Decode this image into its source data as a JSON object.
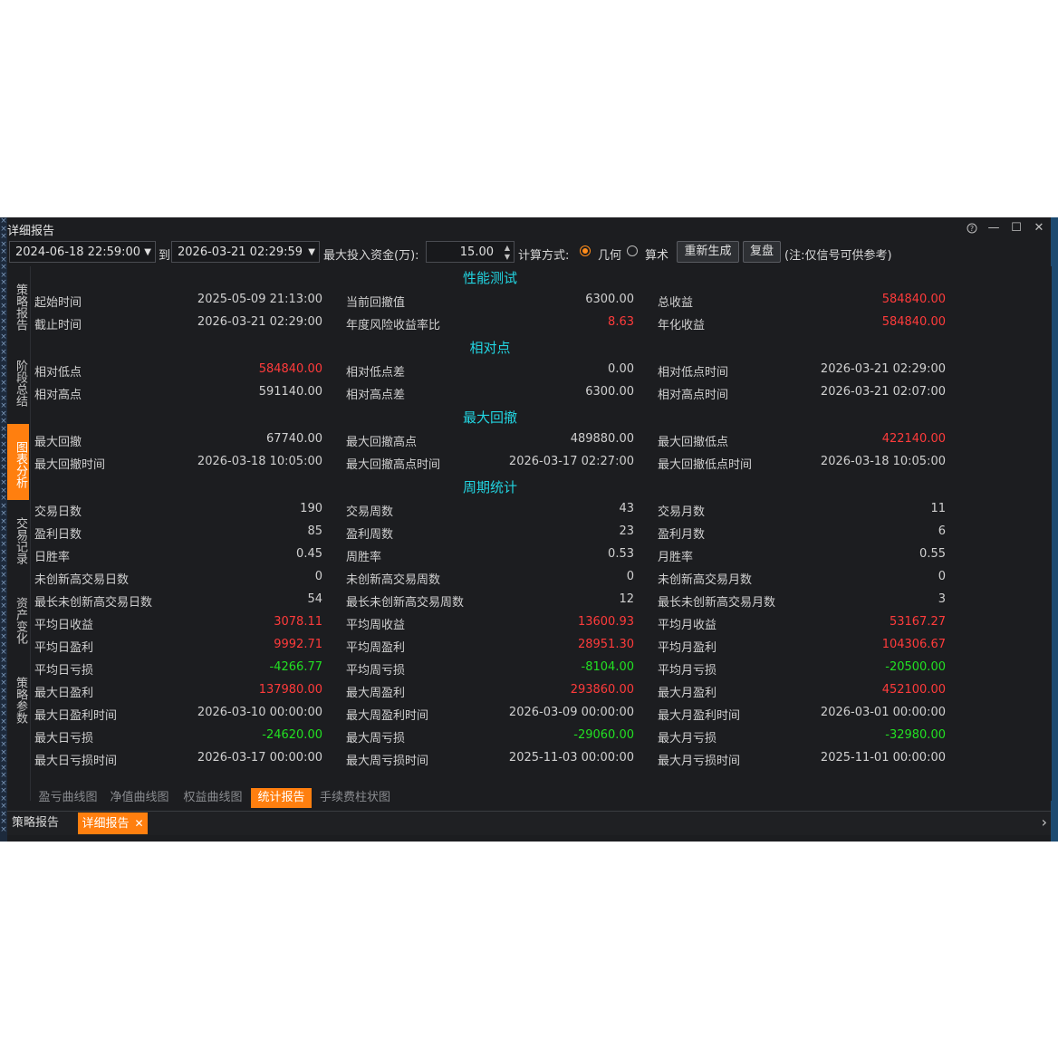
{
  "window": {
    "title": "详细报告",
    "controls": {
      "help": "?",
      "minimize": "—",
      "maximize": "☐",
      "close": "✕"
    }
  },
  "toolbar": {
    "start_date": "2024-06-18 22:59:00",
    "to_label": "到",
    "end_date": "2026-03-21 02:29:59",
    "max_capital_label": "最大投入资金(万):",
    "max_capital_value": "15.00",
    "calc_method_label": "计算方式:",
    "calc_options": [
      {
        "label": "几何",
        "selected": true
      },
      {
        "label": "算术",
        "selected": false
      }
    ],
    "regenerate_button": "重新生成",
    "review_button": "复盘",
    "note": "(注:仅信号可供参考)"
  },
  "side_tabs": [
    {
      "label": "策略报告",
      "active": false
    },
    {
      "label": "阶段总结",
      "active": false
    },
    {
      "label": "图表分析",
      "active": true
    },
    {
      "label": "交易记录",
      "active": false
    },
    {
      "label": "资产变化",
      "active": false
    },
    {
      "label": "策略参数",
      "active": false
    }
  ],
  "sections": [
    {
      "title": "性能测试",
      "rows": [
        [
          {
            "k": "起始时间",
            "v": "2025-05-09 21:13:00",
            "c": "n"
          },
          {
            "k": "当前回撤值",
            "v": "6300.00",
            "c": "n"
          },
          {
            "k": "总收益",
            "v": "584840.00",
            "c": "r"
          }
        ],
        [
          {
            "k": "截止时间",
            "v": "2026-03-21 02:29:00",
            "c": "n"
          },
          {
            "k": "年度风险收益率比",
            "v": "8.63",
            "c": "r"
          },
          {
            "k": "年化收益",
            "v": "584840.00",
            "c": "r"
          }
        ]
      ]
    },
    {
      "title": "相对点",
      "rows": [
        [
          {
            "k": "相对低点",
            "v": "584840.00",
            "c": "r"
          },
          {
            "k": "相对低点差",
            "v": "0.00",
            "c": "n"
          },
          {
            "k": "相对低点时间",
            "v": "2026-03-21 02:29:00",
            "c": "n"
          }
        ],
        [
          {
            "k": "相对高点",
            "v": "591140.00",
            "c": "n"
          },
          {
            "k": "相对高点差",
            "v": "6300.00",
            "c": "n"
          },
          {
            "k": "相对高点时间",
            "v": "2026-03-21 02:07:00",
            "c": "n"
          }
        ]
      ]
    },
    {
      "title": "最大回撤",
      "rows": [
        [
          {
            "k": "最大回撤",
            "v": "67740.00",
            "c": "n"
          },
          {
            "k": "最大回撤高点",
            "v": "489880.00",
            "c": "n"
          },
          {
            "k": "最大回撤低点",
            "v": "422140.00",
            "c": "r"
          }
        ],
        [
          {
            "k": "最大回撤时间",
            "v": "2026-03-18 10:05:00",
            "c": "n"
          },
          {
            "k": "最大回撤高点时间",
            "v": "2026-03-17 02:27:00",
            "c": "n"
          },
          {
            "k": "最大回撤低点时间",
            "v": "2026-03-18 10:05:00",
            "c": "n"
          }
        ]
      ]
    },
    {
      "title": "周期统计",
      "rows": [
        [
          {
            "k": "交易日数",
            "v": "190",
            "c": "n"
          },
          {
            "k": "交易周数",
            "v": "43",
            "c": "n"
          },
          {
            "k": "交易月数",
            "v": "11",
            "c": "n"
          }
        ],
        [
          {
            "k": "盈利日数",
            "v": "85",
            "c": "n"
          },
          {
            "k": "盈利周数",
            "v": "23",
            "c": "n"
          },
          {
            "k": "盈利月数",
            "v": "6",
            "c": "n"
          }
        ],
        [
          {
            "k": "日胜率",
            "v": "0.45",
            "c": "n"
          },
          {
            "k": "周胜率",
            "v": "0.53",
            "c": "n"
          },
          {
            "k": "月胜率",
            "v": "0.55",
            "c": "n"
          }
        ],
        [
          {
            "k": "未创新高交易日数",
            "v": "0",
            "c": "n"
          },
          {
            "k": "未创新高交易周数",
            "v": "0",
            "c": "n"
          },
          {
            "k": "未创新高交易月数",
            "v": "0",
            "c": "n"
          }
        ],
        [
          {
            "k": "最长未创新高交易日数",
            "v": "54",
            "c": "n"
          },
          {
            "k": "最长未创新高交易周数",
            "v": "12",
            "c": "n"
          },
          {
            "k": "最长未创新高交易月数",
            "v": "3",
            "c": "n"
          }
        ],
        [
          {
            "k": "平均日收益",
            "v": "3078.11",
            "c": "r"
          },
          {
            "k": "平均周收益",
            "v": "13600.93",
            "c": "r"
          },
          {
            "k": "平均月收益",
            "v": "53167.27",
            "c": "r"
          }
        ],
        [
          {
            "k": "平均日盈利",
            "v": "9992.71",
            "c": "r"
          },
          {
            "k": "平均周盈利",
            "v": "28951.30",
            "c": "r"
          },
          {
            "k": "平均月盈利",
            "v": "104306.67",
            "c": "r"
          }
        ],
        [
          {
            "k": "平均日亏损",
            "v": "-4266.77",
            "c": "g"
          },
          {
            "k": "平均周亏损",
            "v": "-8104.00",
            "c": "g"
          },
          {
            "k": "平均月亏损",
            "v": "-20500.00",
            "c": "g"
          }
        ],
        [
          {
            "k": "最大日盈利",
            "v": "137980.00",
            "c": "r"
          },
          {
            "k": "最大周盈利",
            "v": "293860.00",
            "c": "r"
          },
          {
            "k": "最大月盈利",
            "v": "452100.00",
            "c": "r"
          }
        ],
        [
          {
            "k": "最大日盈利时间",
            "v": "2026-03-10 00:00:00",
            "c": "n"
          },
          {
            "k": "最大周盈利时间",
            "v": "2026-03-09 00:00:00",
            "c": "n"
          },
          {
            "k": "最大月盈利时间",
            "v": "2026-03-01 00:00:00",
            "c": "n"
          }
        ],
        [
          {
            "k": "最大日亏损",
            "v": "-24620.00",
            "c": "g"
          },
          {
            "k": "最大周亏损",
            "v": "-29060.00",
            "c": "g"
          },
          {
            "k": "最大月亏损",
            "v": "-32980.00",
            "c": "g"
          }
        ],
        [
          {
            "k": "最大日亏损时间",
            "v": "2026-03-17 00:00:00",
            "c": "n"
          },
          {
            "k": "最大周亏损时间",
            "v": "2025-11-03 00:00:00",
            "c": "n"
          },
          {
            "k": "最大月亏损时间",
            "v": "2025-11-01 00:00:00",
            "c": "n"
          }
        ]
      ]
    }
  ],
  "sub_tabs": [
    {
      "label": "盈亏曲线图",
      "active": false
    },
    {
      "label": "净值曲线图",
      "active": false
    },
    {
      "label": "权益曲线图",
      "active": false
    },
    {
      "label": "统计报告",
      "active": true
    },
    {
      "label": "手续费柱状图",
      "active": false
    }
  ],
  "bottom_tabs": [
    {
      "label": "策略报告",
      "active": false,
      "closable": false
    },
    {
      "label": "详细报告",
      "active": true,
      "closable": true
    }
  ],
  "colors": {
    "accent": "#ff7f0f",
    "section_title": "#22d4e0",
    "positive": "#ff3b3b",
    "negative": "#22e022",
    "background": "#1c1d20"
  }
}
